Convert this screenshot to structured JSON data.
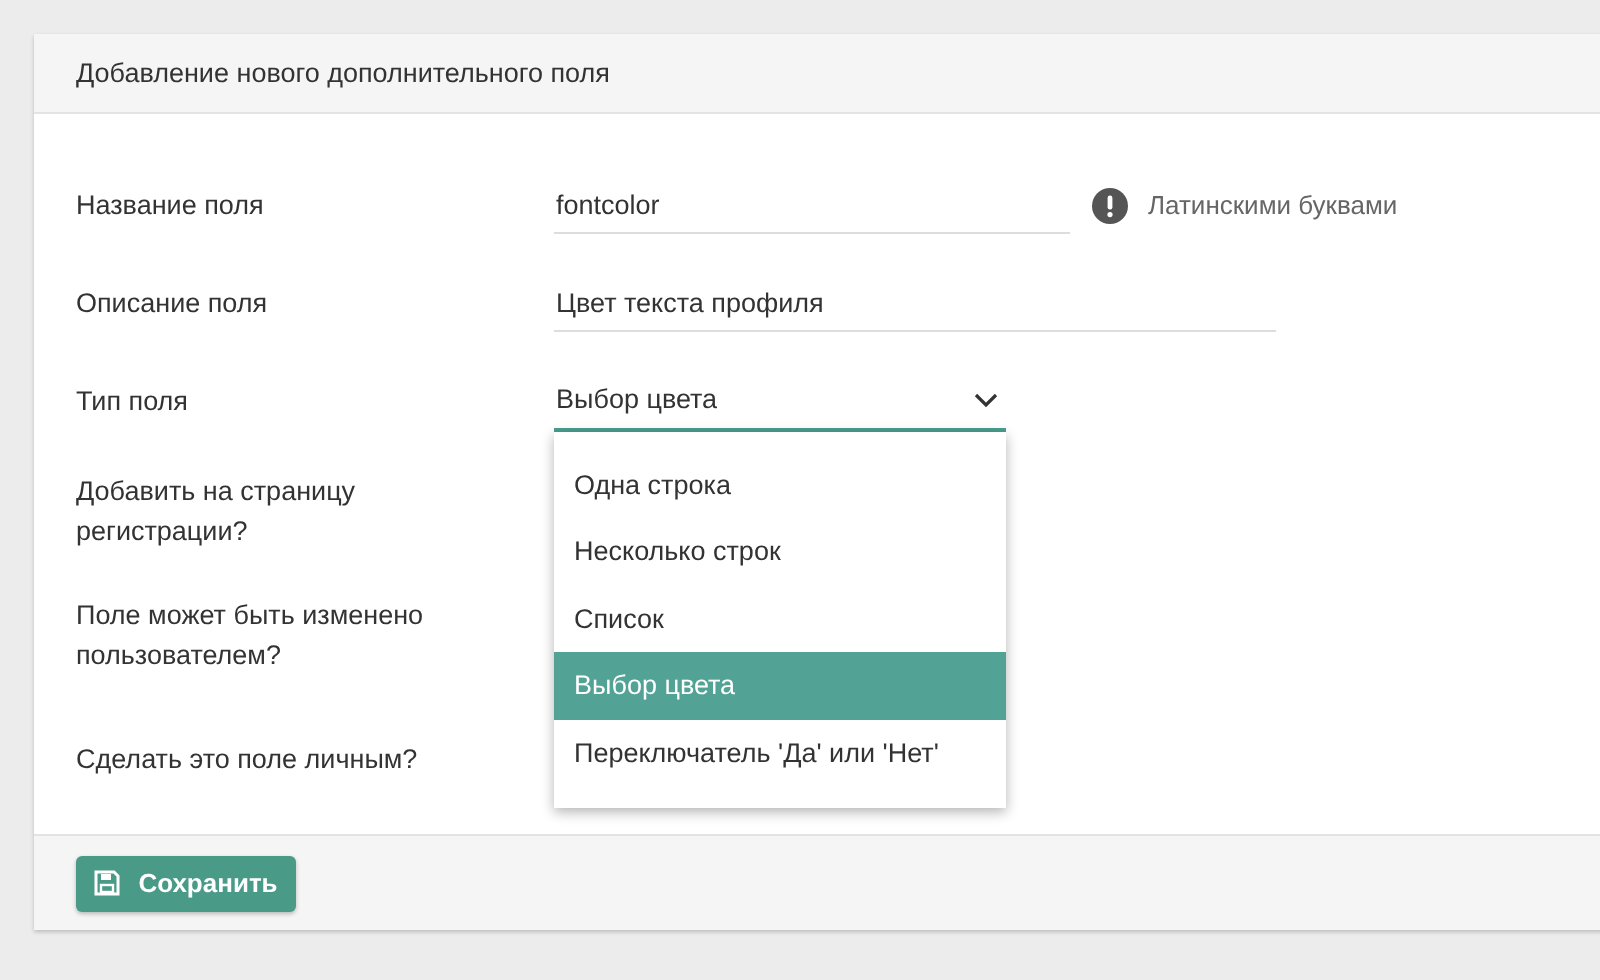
{
  "panel": {
    "title": "Добавление нового дополнительного поля"
  },
  "fields": [
    {
      "kind": "text",
      "label": "Название поля",
      "value": "fontcolor",
      "hint": "Латинскими буквами"
    },
    {
      "kind": "text",
      "label": "Описание поля",
      "value": "Цвет текста профиля"
    },
    {
      "kind": "select",
      "label": "Тип поля",
      "value": "Выбор цвета",
      "expanded": true,
      "options": [
        {
          "label": "Одна строка",
          "selected": false
        },
        {
          "label": "Несколько строк",
          "selected": false
        },
        {
          "label": "Список",
          "selected": false
        },
        {
          "label": "Выбор цвета",
          "selected": true
        },
        {
          "label": "Переключатель 'Да' или 'Нет'",
          "selected": false
        }
      ]
    },
    {
      "kind": "label",
      "label": "Добавить на страницу регистрации?"
    },
    {
      "kind": "label",
      "label": "Поле может быть изменено пользователем?"
    },
    {
      "kind": "label",
      "label": "Сделать это поле личным?"
    }
  ],
  "save_button": "Сохранить"
}
